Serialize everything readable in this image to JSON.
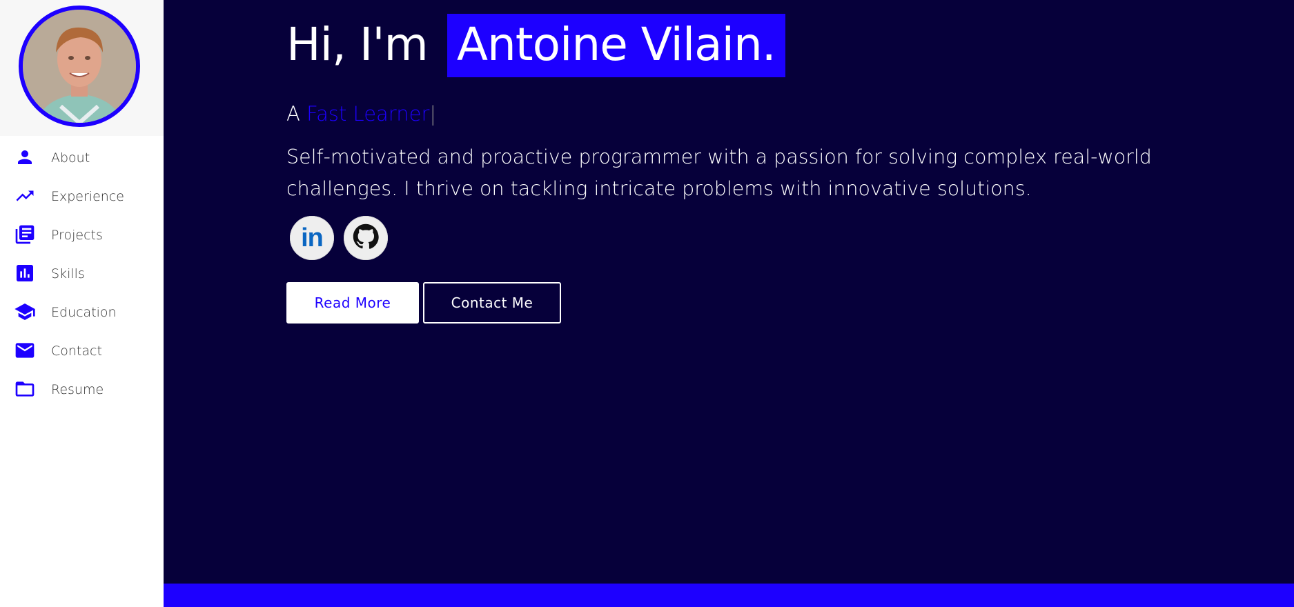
{
  "sidebar": {
    "items": [
      {
        "label": "About",
        "icon": "person-icon"
      },
      {
        "label": "Experience",
        "icon": "trending-up-icon"
      },
      {
        "label": "Projects",
        "icon": "library-books-icon"
      },
      {
        "label": "Skills",
        "icon": "bar-chart-icon"
      },
      {
        "label": "Education",
        "icon": "graduation-cap-icon"
      },
      {
        "label": "Contact",
        "icon": "mail-icon"
      },
      {
        "label": "Resume",
        "icon": "folder-icon"
      }
    ]
  },
  "hero": {
    "greeting": "Hi, I'm",
    "name": "Antoine Vilain.",
    "tagline_prefix": "A",
    "tagline_typed": "Fast Learner",
    "tagline_cursor": "|",
    "bio": "Self-motivated and proactive programmer with a passion for solving complex real-world challenges. I thrive on tackling intricate problems with innovative solutions.",
    "linkedin_text": "in",
    "read_more_label": "Read More",
    "contact_label": "Contact Me"
  },
  "colors": {
    "accent": "#1d00ff",
    "background": "#06003a",
    "sidebar": "#ffffff"
  }
}
